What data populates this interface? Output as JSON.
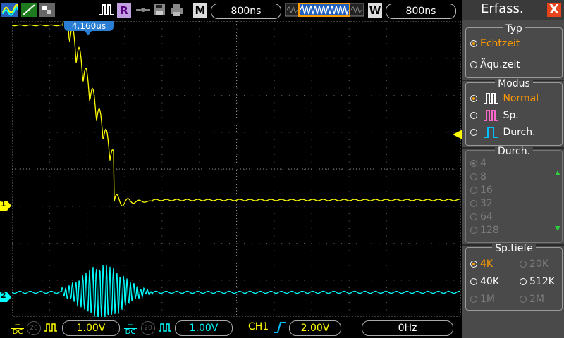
{
  "topbar": {
    "run_mode_label": "R",
    "m_label": "M",
    "m_value": "800ns",
    "w_label": "W",
    "w_value": "800ns"
  },
  "trigger_time_label": "4.160us",
  "channels": [
    {
      "marker": "1",
      "color": "#ffff00"
    },
    {
      "marker": "2",
      "color": "#00ffff"
    }
  ],
  "bottombar": {
    "ch1_scale": "1.00V",
    "ch2_scale": "1.00V",
    "dc_label": "DC",
    "bw_label": "20",
    "trigger_source": "CH1",
    "trigger_level": "2.00V",
    "frequency": "0Hz"
  },
  "menu": {
    "title": "Erfass.",
    "close_label": "X",
    "typ": {
      "title": "Typ",
      "options": [
        "Echtzeit",
        "Äqu.zeit"
      ],
      "selected": 0
    },
    "modus": {
      "title": "Modus",
      "options": [
        "Normal",
        "Sp.",
        "Durch."
      ],
      "selected": 0
    },
    "durch": {
      "title": "Durch.",
      "options": [
        "4",
        "8",
        "16",
        "32",
        "64",
        "128"
      ],
      "selected": 0
    },
    "sptiefe": {
      "title": "Sp.tiefe",
      "options": [
        "4K",
        "20K",
        "40K",
        "512K",
        "1M",
        "2M"
      ],
      "selected": 0
    }
  },
  "colors": {
    "ch1": "#ffff00",
    "ch2": "#00ffff",
    "accent": "#ff9a00",
    "close": "#e8441b",
    "trigger_label_bg": "#2a7fd4"
  }
}
